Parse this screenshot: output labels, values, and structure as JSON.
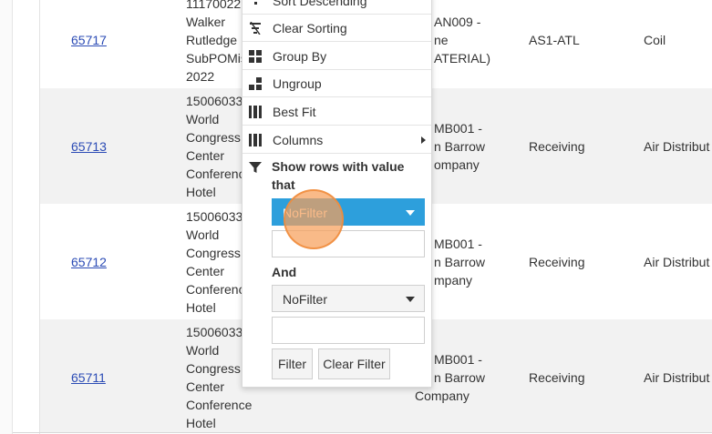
{
  "rows": [
    {
      "po": "65717",
      "job_lines": [
        "11170022",
        "Walker",
        "Rutledge",
        "SubPOMis",
        "2022"
      ],
      "vendor_lines": [
        "AN009 -",
        "ne",
        "ATERIAL)"
      ],
      "location": "AS1-ATL",
      "item": "Coil"
    },
    {
      "po": "65713",
      "job_lines": [
        "15006033",
        "World",
        "Congress",
        "Center",
        "Conferenc",
        "Hotel"
      ],
      "vendor_lines": [
        "MB001 -",
        "n Barrow",
        "ompany"
      ],
      "location": "Receiving",
      "item": "Air Distribut"
    },
    {
      "po": "65712",
      "job_lines": [
        "15006033",
        "World",
        "Congress",
        "Center",
        "Conferenc",
        "Hotel"
      ],
      "vendor_lines": [
        "MB001 -",
        "n Barrow",
        "mpany"
      ],
      "location": "Receiving",
      "item": "Air Distribut"
    },
    {
      "po": "65711",
      "job_lines": [
        "15006033",
        "World",
        "Congress",
        "Center",
        "Conference",
        "Hotel"
      ],
      "vendor_lines": [
        "MB001 -",
        "n Barrow",
        "Company"
      ],
      "location": "Receiving",
      "item": "Air Distribut"
    }
  ],
  "column_menu": {
    "items": [
      {
        "label": "Sort Descending",
        "icon": "sort-descending-icon"
      },
      {
        "label": "Clear Sorting",
        "icon": "clear-sorting-icon"
      },
      {
        "label": "Group By",
        "icon": "group-by-icon"
      },
      {
        "label": "Ungroup",
        "icon": "ungroup-icon"
      },
      {
        "label": "Best Fit",
        "icon": "best-fit-icon"
      },
      {
        "label": "Columns",
        "icon": "columns-icon"
      }
    ],
    "filter": {
      "title": "Show rows with value that",
      "first_operator": "NoFilter",
      "first_value": "",
      "logic_label": "And",
      "second_operator": "NoFilter",
      "second_value": "",
      "filter_button": "Filter",
      "clear_button": "Clear Filter"
    }
  },
  "colors": {
    "accent": "#2d9fdc",
    "link": "#2b4bb5",
    "row_alt": "#f2f2f2",
    "click_indicator": "#f7a05a"
  }
}
